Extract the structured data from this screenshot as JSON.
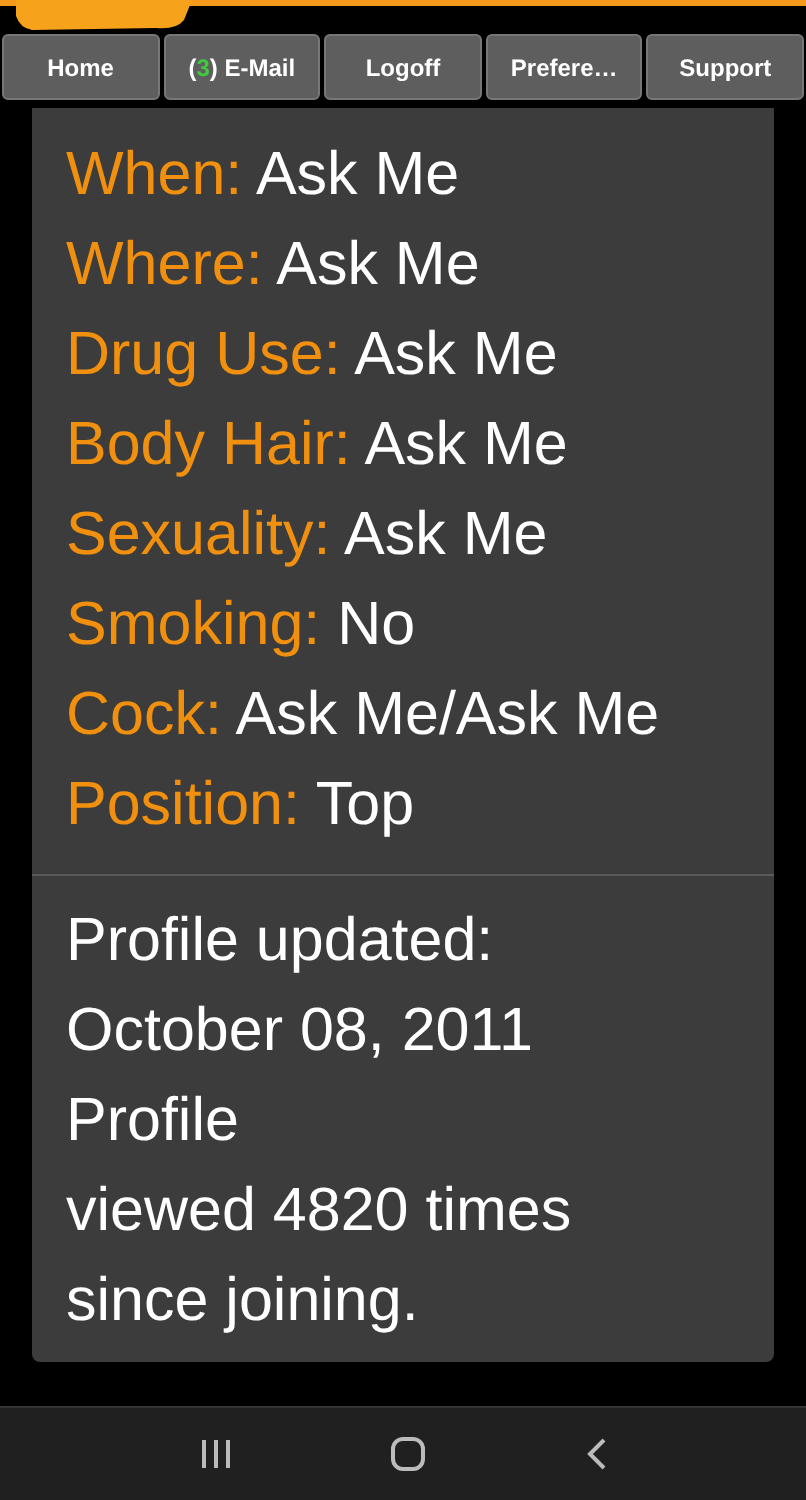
{
  "nav": [
    {
      "parts": [
        {
          "text": "Home"
        }
      ]
    },
    {
      "parts": [
        {
          "text": "("
        },
        {
          "text": "3",
          "kind": "count"
        },
        {
          "text": ") E-Mail"
        }
      ]
    },
    {
      "parts": [
        {
          "text": "Logoff"
        }
      ]
    },
    {
      "parts": [
        {
          "text": "Prefere…"
        }
      ]
    },
    {
      "parts": [
        {
          "text": "Support"
        }
      ]
    }
  ],
  "fields": [
    {
      "label": "When:",
      "value": "Ask Me"
    },
    {
      "label": "Where:",
      "value": "Ask Me"
    },
    {
      "label": "Drug Use:",
      "value": "Ask Me"
    },
    {
      "label": "Body Hair:",
      "value": "Ask Me"
    },
    {
      "label": "Sexuality:",
      "value": "Ask Me"
    },
    {
      "label": "Smoking:",
      "value": "No"
    },
    {
      "label": "Cock:",
      "value": "Ask Me/Ask Me"
    },
    {
      "label": "Position:",
      "value": "Top"
    }
  ],
  "footer_lines": [
    "Profile updated:",
    "October 08, 2011",
    "Profile",
    "viewed 4820 times",
    "since joining."
  ]
}
